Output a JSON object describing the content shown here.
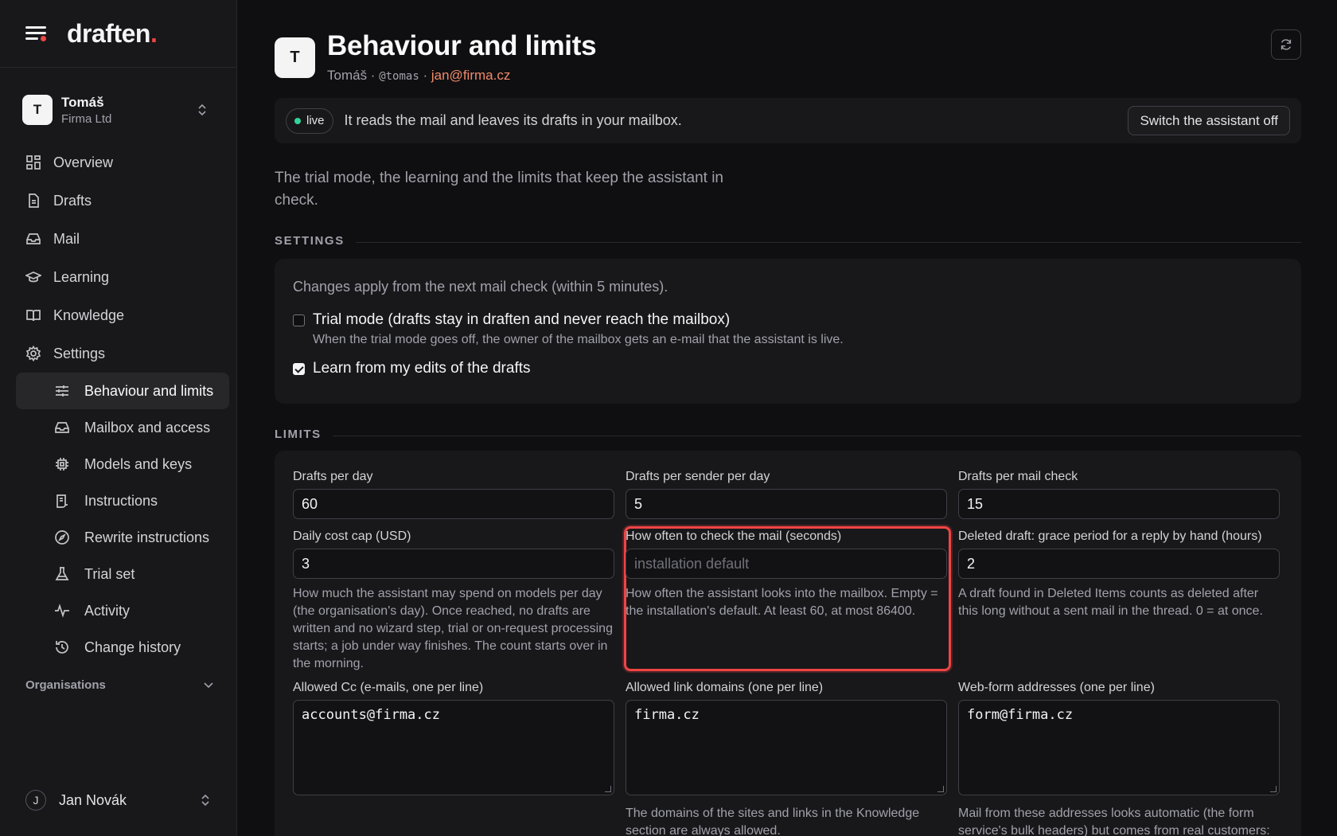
{
  "brand": {
    "name": "draften",
    "accent": "."
  },
  "account": {
    "initial": "T",
    "name": "Tomáš",
    "org": "Firma Ltd"
  },
  "nav": {
    "overview": "Overview",
    "drafts": "Drafts",
    "mail": "Mail",
    "learning": "Learning",
    "knowledge": "Knowledge",
    "settings": "Settings",
    "sub": {
      "behaviour": "Behaviour and limits",
      "mailbox": "Mailbox and access",
      "models": "Models and keys",
      "instructions": "Instructions",
      "rewrite": "Rewrite instructions",
      "trial": "Trial set",
      "activity": "Activity",
      "history": "Change history"
    },
    "organisations": "Organisations"
  },
  "user": {
    "initial": "J",
    "name": "Jan Novák"
  },
  "page": {
    "initial": "T",
    "title": "Behaviour and limits",
    "owner": "Tomáš",
    "handle": "@tomas",
    "email": "jan@firma.cz",
    "sep": " · "
  },
  "status": {
    "pill": "live",
    "text": "It reads the mail and leaves its drafts in your mailbox.",
    "switch_label": "Switch the assistant off"
  },
  "lead": "The trial mode, the learning and the limits that keep the assistant in check.",
  "settings": {
    "label": "SETTINGS",
    "note": "Changes apply from the next mail check (within 5 minutes).",
    "trial": {
      "label": "Trial mode (drafts stay in draften and never reach the mailbox)",
      "help": "When the trial mode goes off, the owner of the mailbox gets an e-mail that the assistant is live.",
      "checked": false
    },
    "learn": {
      "label": "Learn from my edits of the drafts",
      "checked": true
    }
  },
  "limits": {
    "label": "LIMITS",
    "drafts_per_day": {
      "label": "Drafts per day",
      "value": "60"
    },
    "drafts_per_sender": {
      "label": "Drafts per sender per day",
      "value": "5"
    },
    "drafts_per_check": {
      "label": "Drafts per mail check",
      "value": "15"
    },
    "cost_cap": {
      "label": "Daily cost cap (USD)",
      "value": "3",
      "help": "How much the assistant may spend on models per day (the organisation's day). Once reached, no drafts are written and no wizard step, trial or on-request processing starts; a job under way finishes. The count starts over in the morning."
    },
    "check_interval": {
      "label": "How often to check the mail (seconds)",
      "placeholder": "installation default",
      "help": "How often the assistant looks into the mailbox. Empty = the installation's default. At least 60, at most 86400."
    },
    "grace": {
      "label": "Deleted draft: grace period for a reply by hand (hours)",
      "value": "2",
      "help": "A draft found in Deleted Items counts as deleted after this long without a sent mail in the thread. 0 = at once."
    },
    "allowed_cc": {
      "label": "Allowed Cc (e-mails, one per line)",
      "value": "accounts@firma.cz"
    },
    "link_domains": {
      "label": "Allowed link domains (one per line)",
      "value": "firma.cz",
      "help": "The domains of the sites and links in the Knowledge section are always allowed."
    },
    "webform": {
      "label": "Web-form addresses (one per line)",
      "value": "form@firma.cz",
      "help": "Mail from these addresses looks automatic (the form service's bulk headers) but comes from real customers:"
    }
  },
  "colors": {
    "accent": "#ef4444",
    "live": "#34d399",
    "email": "#f08a6a"
  }
}
